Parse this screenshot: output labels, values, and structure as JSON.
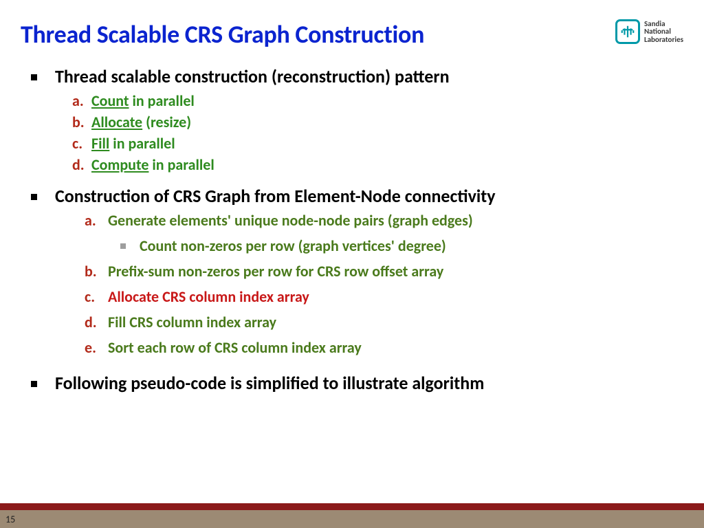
{
  "title": "Thread Scalable CRS Graph Construction",
  "logo": {
    "line1": "Sandia",
    "line2": "National",
    "line3": "Laboratories"
  },
  "b1": "Thread scalable construction (reconstruction) pattern",
  "p1": {
    "a": {
      "u": "Count",
      "rest": " in parallel"
    },
    "b": {
      "u": "Allocate",
      "rest": " (resize)"
    },
    "c": {
      "u": "Fill",
      "rest": " in parallel"
    },
    "d": {
      "u": "Compute",
      "rest": " in parallel"
    }
  },
  "b2": "Construction of CRS Graph from Element-Node connectivity",
  "p2": {
    "a": "Generate elements' unique node-node pairs (graph edges)",
    "a_sub": "Count non-zeros per row (graph vertices' degree)",
    "b": "Prefix-sum non-zeros per row for CRS row offset array",
    "c": "Allocate CRS column index array",
    "d": "Fill CRS column index array",
    "e": "Sort each row of CRS column index array"
  },
  "b3": "Following pseudo-code is simplified to illustrate algorithm",
  "letters": {
    "a": "a.",
    "b": "b.",
    "c": "c.",
    "d": "d.",
    "e": "e."
  },
  "page": "15"
}
